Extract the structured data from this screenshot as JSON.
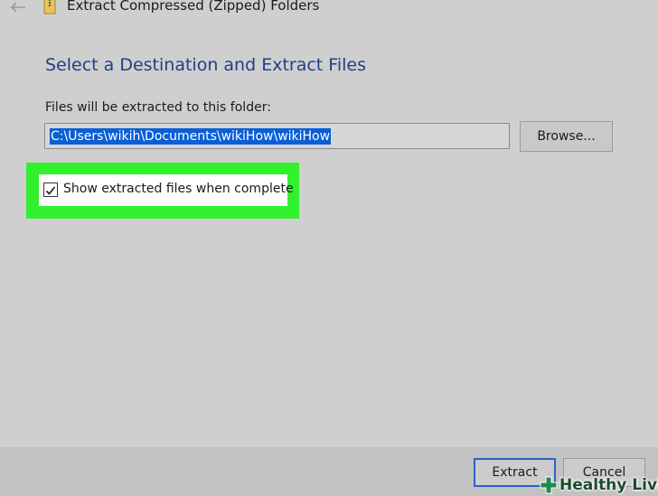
{
  "window": {
    "title": "Extract Compressed (Zipped) Folders",
    "icons": {
      "back": "back-arrow-icon",
      "folder": "zip-folder-icon"
    }
  },
  "main": {
    "heading": "Select a Destination and Extract Files",
    "path_label": "Files will be extracted to this folder:",
    "path_value": "C:\\Users\\wikih\\Documents\\wikiHow\\wikiHow",
    "browse_label": "Browse...",
    "show_files_checkbox": {
      "label": "Show extracted files when complete",
      "checked": true
    },
    "highlight_color": "#33f02f"
  },
  "footer": {
    "extract_label": "Extract",
    "cancel_label": "Cancel"
  },
  "watermark": {
    "text": "Healthy Living",
    "icon": "plus-cross-icon"
  },
  "colors": {
    "heading": "#1f3f8a",
    "selection": "#0a5fd6",
    "default_button_border": "#2a62c9"
  }
}
